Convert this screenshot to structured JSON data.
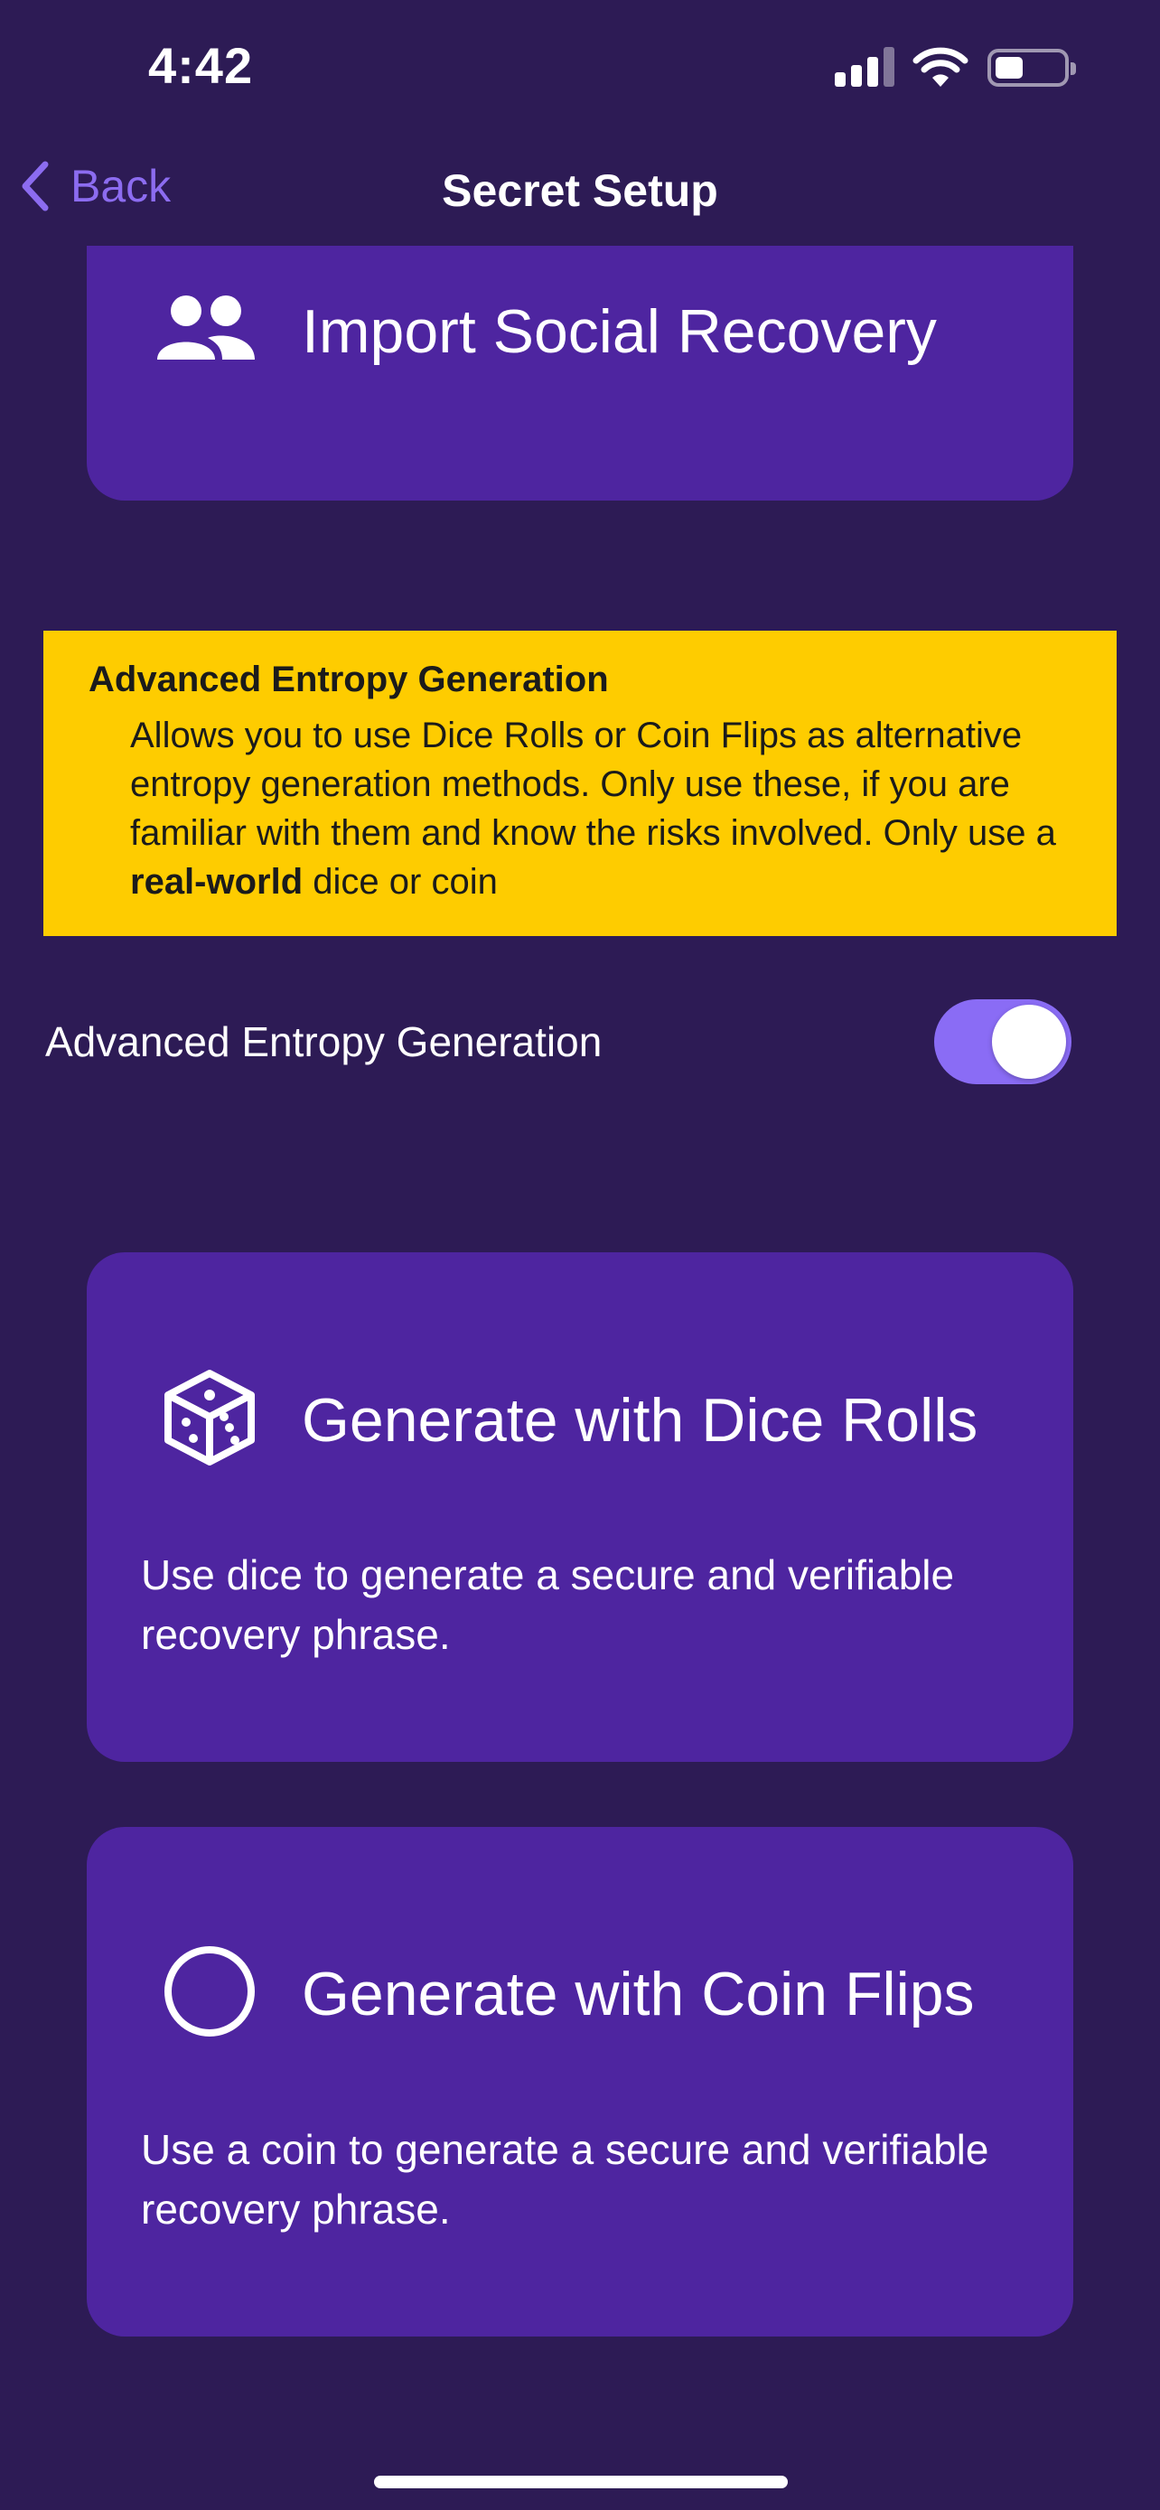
{
  "status_bar": {
    "time": "4:42",
    "signal_bars_active": 3,
    "signal_bars_total": 4,
    "battery_level": 0.35,
    "icons": [
      "signal-icon",
      "wifi-icon",
      "battery-icon"
    ]
  },
  "nav": {
    "back_label": "Back",
    "title": "Secret Setup"
  },
  "import_card": {
    "title": "Import Social Recovery",
    "icon": "people-icon"
  },
  "warning_banner": {
    "title": "Advanced Entropy Generation",
    "text_before": "Allows you to use Dice Rolls or Coin Flips as alternative entropy generation methods. Only use these, if you are familiar with them and know the risks involved. Only use a ",
    "text_bold": "real-world",
    "text_after": " dice or coin"
  },
  "toggle": {
    "label": "Advanced Entropy Generation",
    "state": "on"
  },
  "dice_card": {
    "title": "Generate with Dice Rolls",
    "description": "Use dice to generate a secure and verifiable recovery phrase.",
    "icon": "dice-icon"
  },
  "coin_card": {
    "title": "Generate with Coin Flips",
    "description": "Use a coin to generate a secure and verifiable recovery phrase.",
    "icon": "coin-icon"
  },
  "colors": {
    "background": "#2d1b55",
    "card": "#4e25a0",
    "accent": "#8c6cf0",
    "banner": "#fecc00"
  }
}
